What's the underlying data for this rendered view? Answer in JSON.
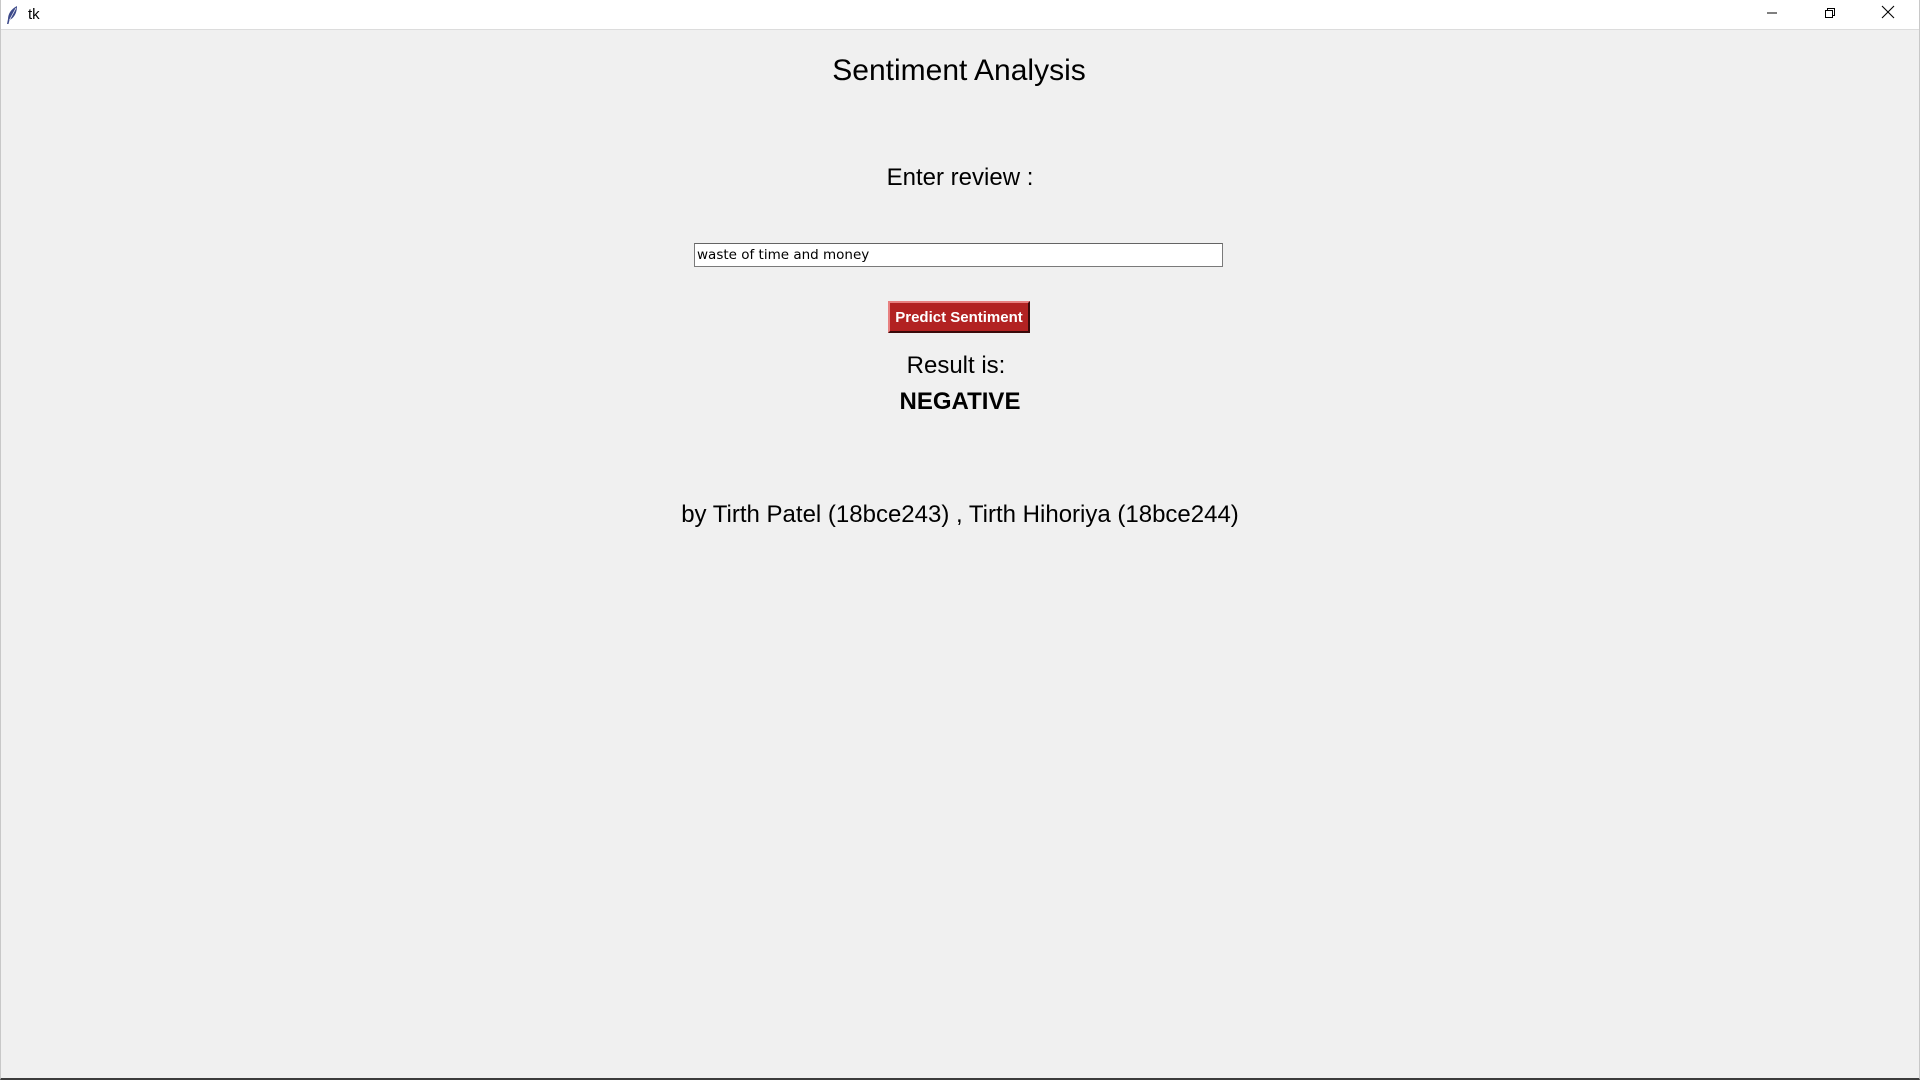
{
  "window": {
    "title": "tk",
    "controls": {
      "minimize_icon": "minimize-icon",
      "maximize_icon": "restore-icon",
      "close_icon": "close-icon"
    }
  },
  "app": {
    "heading": "Sentiment Analysis",
    "review_label": "Enter review :",
    "review_input_value": "waste of time and money",
    "predict_button_label": "Predict Sentiment",
    "result_label": "Result is:",
    "result_value": "NEGATIVE",
    "credits": "by Tirth Patel (18bce243) , Tirth Hihoriya (18bce244)"
  },
  "colors": {
    "background": "#f0f0f0",
    "button_bg": "#b22222",
    "button_text": "#ffffff"
  }
}
